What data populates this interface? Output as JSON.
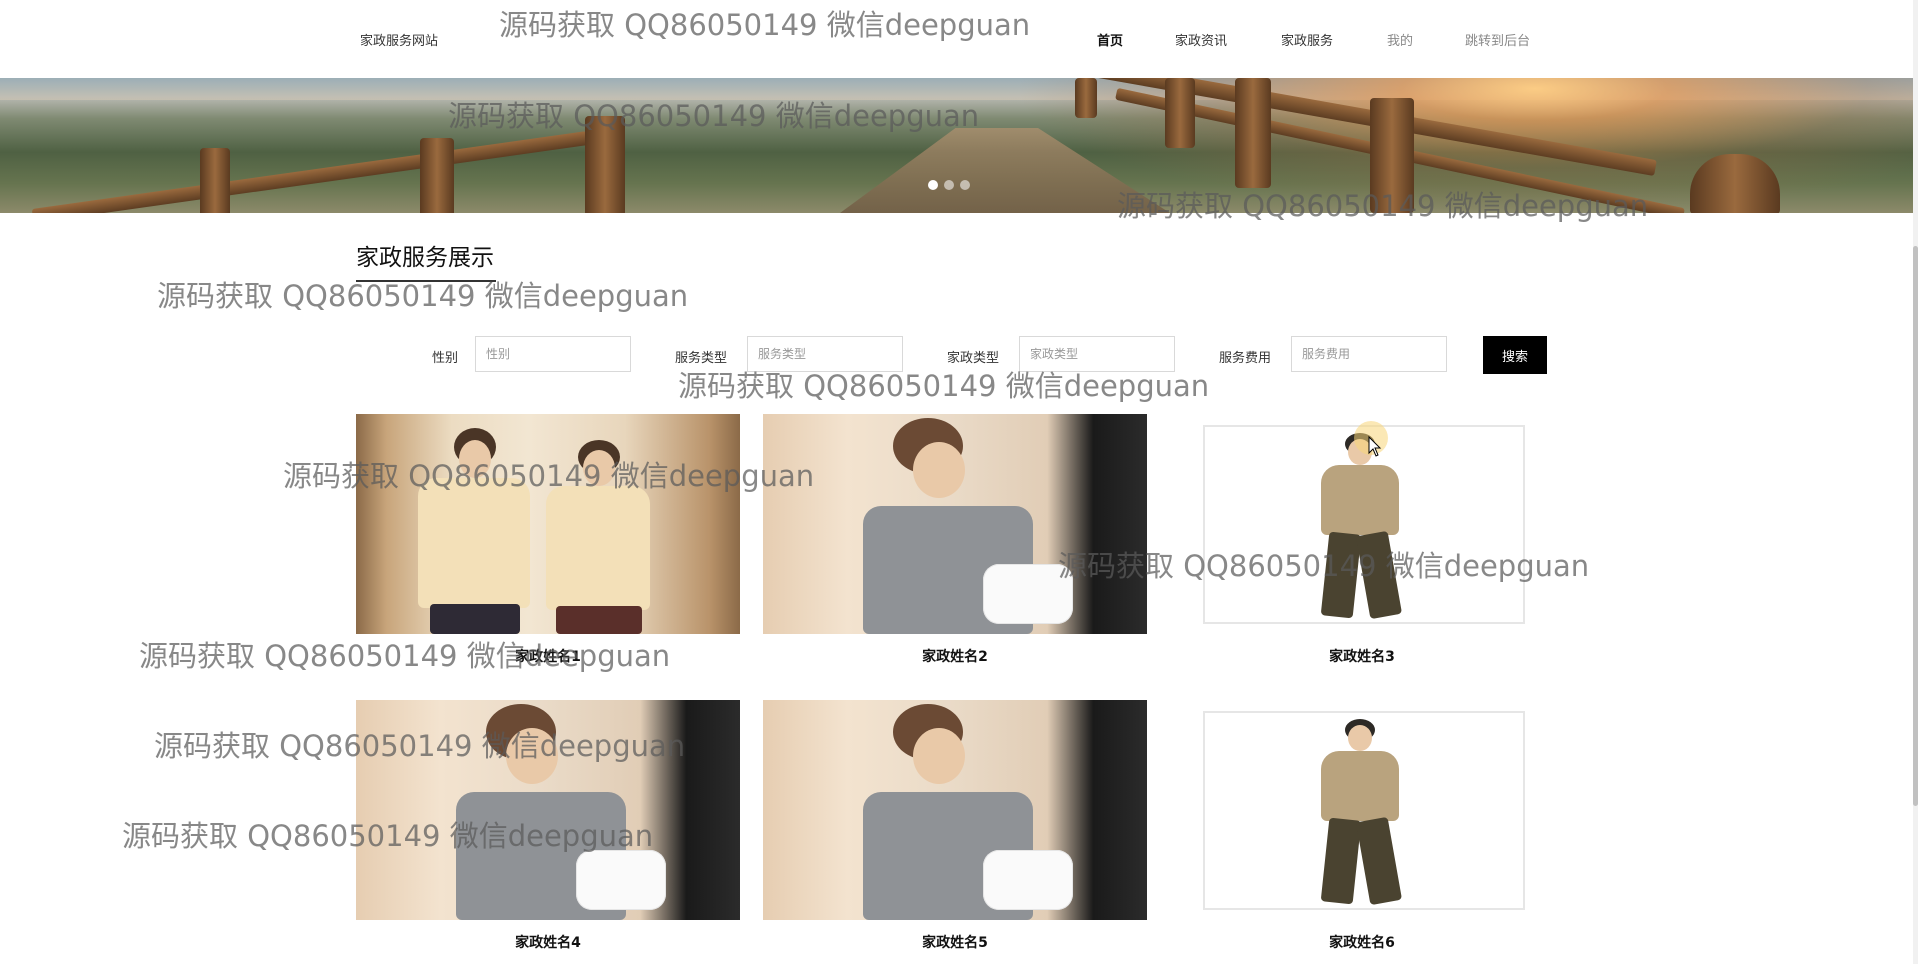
{
  "header": {
    "site_title": "家政服务网站",
    "nav": [
      {
        "label": "首页"
      },
      {
        "label": "家政资讯"
      },
      {
        "label": "家政服务"
      },
      {
        "label": "我的"
      },
      {
        "label": "跳转到后台"
      }
    ]
  },
  "banner": {
    "slides": 3,
    "active_slide": 1
  },
  "section": {
    "title": "家政服务展示"
  },
  "filters": [
    {
      "label": "性别",
      "placeholder": "性别"
    },
    {
      "label": "服务类型",
      "placeholder": "服务类型"
    },
    {
      "label": "家政类型",
      "placeholder": "家政类型"
    },
    {
      "label": "服务费用",
      "placeholder": "服务费用"
    }
  ],
  "search_button": "搜索",
  "cards": [
    {
      "name": "家政姓名1"
    },
    {
      "name": "家政姓名2"
    },
    {
      "name": "家政姓名3"
    },
    {
      "name": "家政姓名4"
    },
    {
      "name": "家政姓名5"
    },
    {
      "name": "家政姓名6"
    }
  ],
  "watermark_text": "源码获取 QQ86050149 微信deepguan"
}
